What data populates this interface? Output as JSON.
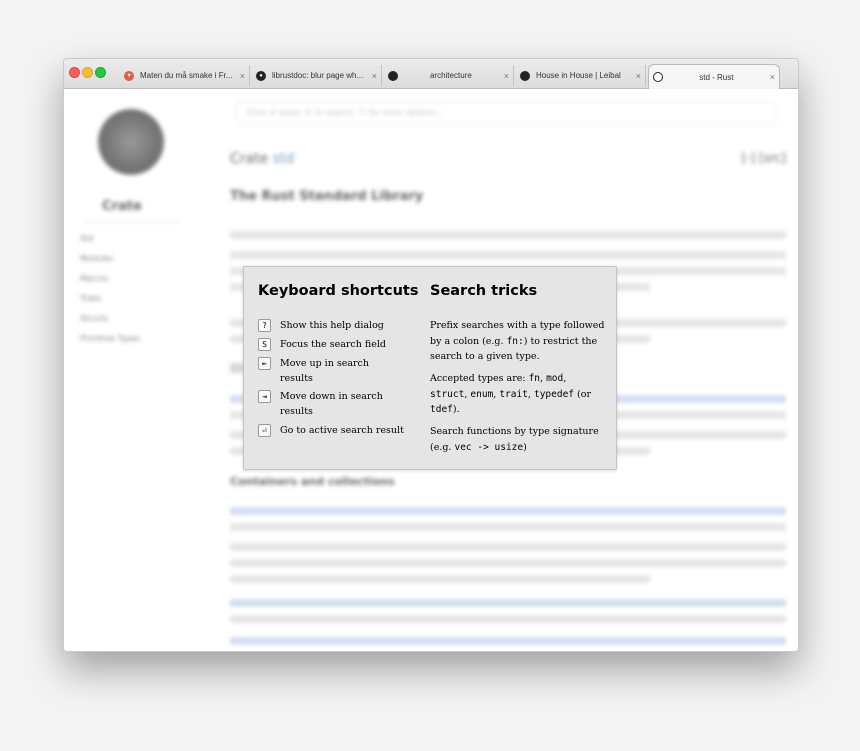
{
  "tabs": [
    {
      "label": "Maten du må smake i Fr...",
      "icon": "heart-icon",
      "icon_color": "#e05d44"
    },
    {
      "label": "librustdoc: blur page wh...",
      "icon": "github-icon",
      "icon_color": "#222222"
    },
    {
      "label": "architecture",
      "icon": "circle-icon",
      "icon_color": "#222222"
    },
    {
      "label": "House in House | Leibal",
      "icon": "circle-icon",
      "icon_color": "#222222"
    },
    {
      "label": "std - Rust",
      "icon": "rust-icon",
      "icon_color": "#222222",
      "active": true
    }
  ],
  "tab_close_glyph": "×",
  "overlay": {
    "shortcuts_title": "Keyboard shortcuts",
    "shortcuts": [
      {
        "key": "?",
        "text": "Show this help dialog"
      },
      {
        "key": "S",
        "text": "Focus the search field"
      },
      {
        "key": "⇤",
        "text": "Move up in search results"
      },
      {
        "key": "⇥",
        "text": "Move down in search results"
      },
      {
        "key": "⏎",
        "text": "Go to active search result"
      }
    ],
    "tricks_title": "Search tricks",
    "tip1": {
      "a": "Prefix searches with a type followed by a colon (e.g. ",
      "code": "fn:",
      "b": ") to restrict the search to a given type."
    },
    "tip2": {
      "a": "Accepted types are: ",
      "c1": "fn",
      "s1": ", ",
      "c2": "mod",
      "s2": ", ",
      "c3": "struct",
      "s3": ", ",
      "c4": "enum",
      "s4": ", ",
      "c5": "trait",
      "s5": ", ",
      "c6": "typedef",
      "s6": " (or ",
      "c7": "tdef",
      "b": ")."
    },
    "tip3": {
      "a": "Search functions by type signature (e.g. ",
      "code": "vec -> usize",
      "b": ")"
    }
  },
  "background": {
    "crate_name": "Crate",
    "search_placeholder": "Click or press 'S' to search, '?' for more options...",
    "title_prefix": "Crate",
    "title_link": "std",
    "src_link": "[-] [src]",
    "heading_main": "The Rust Standard Library",
    "heading_sub": "Containers and collections",
    "sidebar_items": [
      "Std",
      "Modules",
      "Macros",
      "Traits",
      "Structs",
      "Primitive Types"
    ]
  }
}
